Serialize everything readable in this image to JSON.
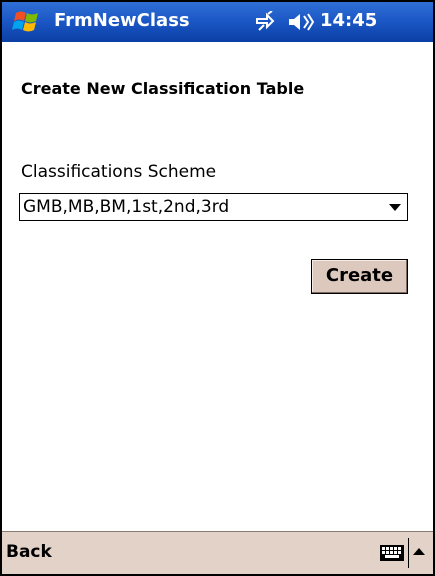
{
  "titlebar": {
    "app_title": "FrmNewClass",
    "clock": "14:45",
    "start_icon": "windows-flag-icon",
    "connectivity_icon": "connectivity-icon",
    "volume_icon": "speaker-icon"
  },
  "form": {
    "heading": "Create New Classification Table",
    "scheme_label": "Classifications Scheme",
    "scheme_selected": "GMB,MB,BM,1st,2nd,3rd",
    "create_label": "Create"
  },
  "menubar": {
    "back_label": "Back",
    "keyboard_icon": "keyboard-icon",
    "sip_arrow_icon": "up-arrow-icon"
  },
  "colors": {
    "titlebar": "#1a56c4",
    "menubar": "#e2d2c7",
    "button": "#dcc8bc"
  }
}
